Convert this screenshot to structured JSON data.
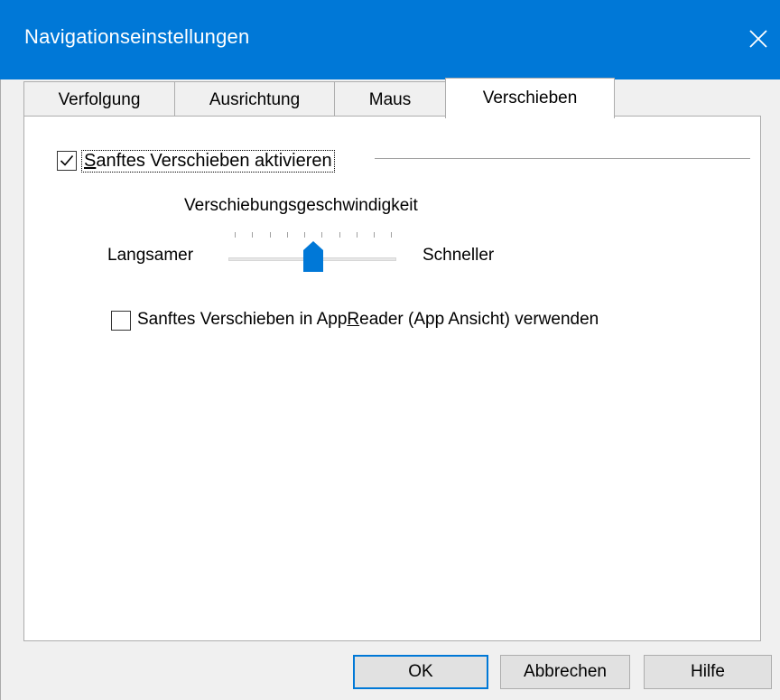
{
  "window": {
    "title": "Navigationseinstellungen",
    "accent_color": "#0078d7",
    "close_icon": "close-icon"
  },
  "tabs": [
    {
      "label": "Verfolgung",
      "active": false
    },
    {
      "label": "Ausrichtung",
      "active": false
    },
    {
      "label": "Maus",
      "active": false
    },
    {
      "label": "Verschieben",
      "active": true
    }
  ],
  "panel": {
    "smooth_scroll_checkbox": {
      "label": "Sanftes Verschieben aktivieren",
      "checked": true
    },
    "speed_label": "Verschiebungsgeschwindigkeit",
    "slower_label": "Langsamer",
    "faster_label": "Schneller",
    "speed_slider": {
      "value": 4,
      "min": 0,
      "max": 9
    },
    "appreader_checkbox": {
      "label_pre": "Sanftes Verschieben in App",
      "label_accel": "R",
      "label_post": "eader (App Ansicht) verwenden",
      "checked": false
    }
  },
  "buttons": {
    "ok": "OK",
    "cancel": "Abbrechen",
    "help": "Hilfe"
  }
}
